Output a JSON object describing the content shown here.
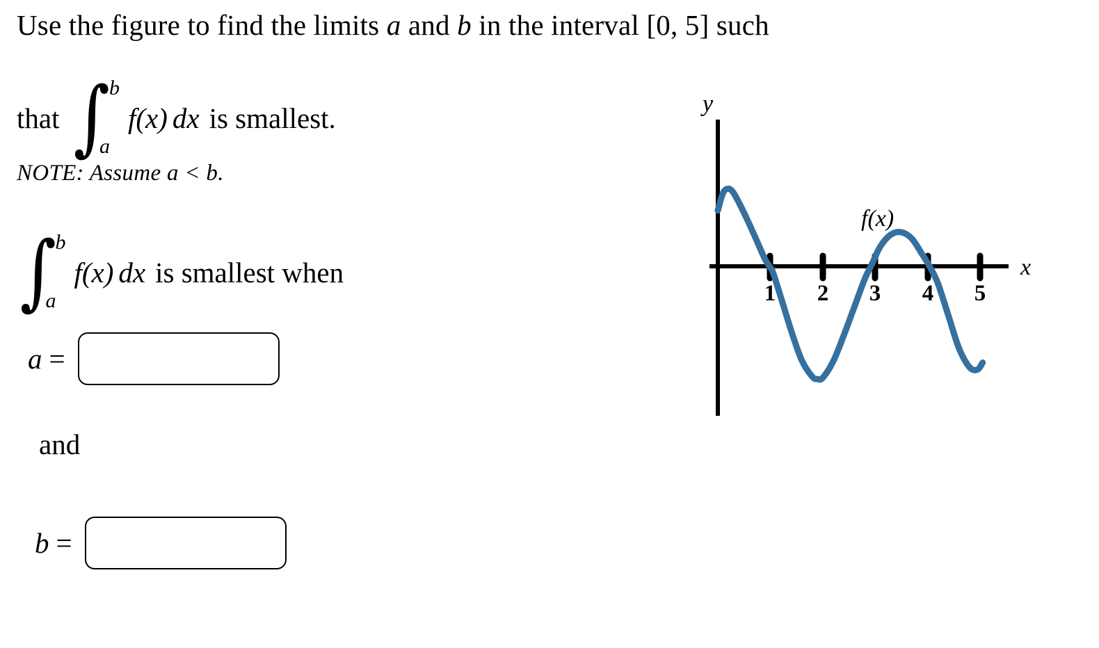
{
  "problem": {
    "line1": "Use the figure to find the limits a and b in the interval [0, 5] such",
    "line1_parts": {
      "t1": "Use the figure to find the limits ",
      "var_a": "a",
      "t2": " and ",
      "var_b": "b",
      "t3": " in the interval [0, 5] such"
    },
    "line2_lead": "that",
    "line2_trail": "is smallest.",
    "note": "NOTE: Assume a < b.",
    "line3_trail": "is smallest when",
    "integral": {
      "sign": "∫",
      "upper": "b",
      "lower": "a",
      "integrand": "f(x)",
      "differential": "dx"
    }
  },
  "answers": {
    "and_label": "and",
    "fields": [
      {
        "id": "a",
        "label": "a",
        "equals": "=",
        "value": "",
        "placeholder": ""
      },
      {
        "id": "b",
        "label": "b",
        "equals": "=",
        "value": "",
        "placeholder": ""
      }
    ]
  },
  "figure": {
    "y_axis_label": "y",
    "x_axis_label": "x",
    "curve_label": "f(x)",
    "curve_color": "#35709f",
    "axis_color": "#000000"
  },
  "chart_data": {
    "type": "line",
    "title": "",
    "xlabel": "x",
    "ylabel": "y",
    "curve_label": "f(x)",
    "xlim": [
      0,
      5.5
    ],
    "ylim": [
      -2.1,
      1.5
    ],
    "grid": false,
    "legend": "none",
    "tick_labels_x": [
      "1",
      "2",
      "3",
      "4",
      "5"
    ],
    "tick_values_x": [
      1,
      2,
      3,
      4,
      5
    ],
    "tick_labels_y": [],
    "series": [
      {
        "name": "f(x)",
        "color": "#35709f",
        "x": [
          0.0,
          0.1,
          0.2,
          0.3,
          0.45,
          0.6,
          0.75,
          0.9,
          1.0,
          1.05,
          1.2,
          1.4,
          1.6,
          1.8,
          1.9,
          2.0,
          2.2,
          2.4,
          2.6,
          2.8,
          2.95,
          3.1,
          3.3,
          3.5,
          3.7,
          3.9,
          4.05,
          4.2,
          4.4,
          4.6,
          4.8,
          4.95,
          5.05
        ],
        "y": [
          0.95,
          1.25,
          1.32,
          1.25,
          1.0,
          0.72,
          0.42,
          0.12,
          -0.02,
          -0.1,
          -0.52,
          -1.1,
          -1.6,
          -1.88,
          -1.92,
          -1.9,
          -1.62,
          -1.18,
          -0.7,
          -0.22,
          0.06,
          0.34,
          0.54,
          0.58,
          0.47,
          0.2,
          -0.02,
          -0.3,
          -0.85,
          -1.4,
          -1.72,
          -1.76,
          -1.64
        ]
      }
    ],
    "key_points": {
      "local_max_1": {
        "x": 0.2,
        "y": 1.32
      },
      "zero_1": {
        "x": 1.02,
        "y": 0
      },
      "local_min_1": {
        "x": 1.88,
        "y": -1.92
      },
      "zero_2": {
        "x": 2.97,
        "y": 0
      },
      "local_max_2": {
        "x": 3.52,
        "y": 0.58
      },
      "zero_3": {
        "x": 4.03,
        "y": 0
      },
      "local_min_2": {
        "x": 4.92,
        "y": -1.77
      }
    },
    "annotations": [
      {
        "text": "f(x)",
        "x": 3.2,
        "y": 0.95
      }
    ]
  }
}
